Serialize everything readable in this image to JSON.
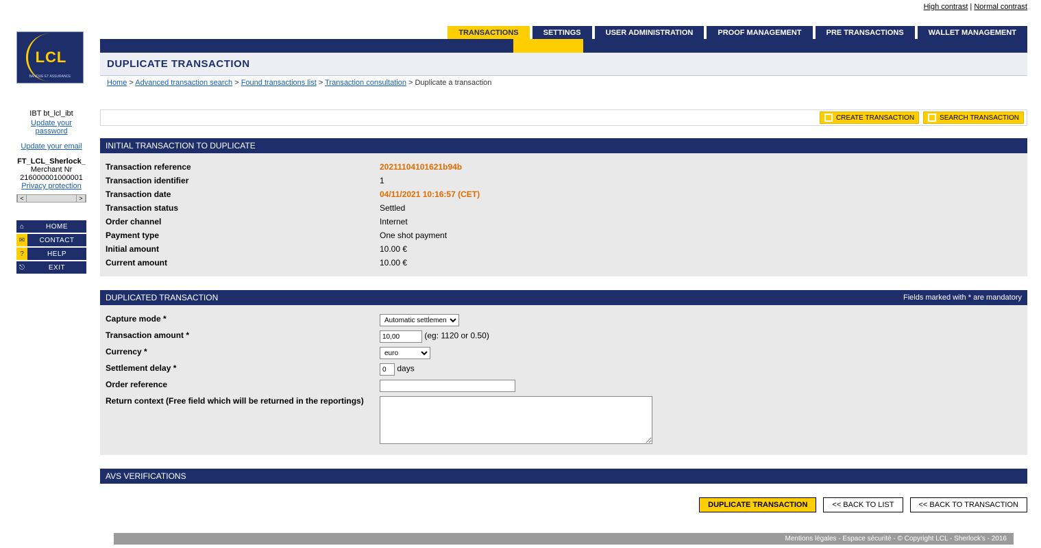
{
  "top_links": {
    "high": "High contrast",
    "sep": " | ",
    "normal": "Normal contrast"
  },
  "logo": {
    "brand": "LCL",
    "tag": "BANQUE ET ASSURANCE"
  },
  "tabs": [
    "TRANSACTIONS",
    "SETTINGS",
    "USER ADMINISTRATION",
    "PROOF MANAGEMENT",
    "PRE TRANSACTIONS",
    "WALLET MANAGEMENT"
  ],
  "tabs_active_index": 0,
  "page_title": "DUPLICATE TRANSACTION",
  "breadcrumb": {
    "items": [
      "Home",
      "Advanced transaction search",
      "Found transactions list",
      "Transaction consultation"
    ],
    "current": "Duplicate a transaction"
  },
  "sidebar": {
    "user_line": "IBT bt_lcl_ibt",
    "links": {
      "update_pwd": "Update your password",
      "update_email": "Update your email",
      "privacy": "Privacy protection"
    },
    "merchant_name": "FT_LCL_Sherlock_",
    "merchant_label": "Merchant Nr",
    "merchant_nr": "216000001000001",
    "buttons": {
      "home": "HOME",
      "contact": "CONTACT",
      "help": "HELP",
      "exit": "EXIT"
    }
  },
  "toolbar": {
    "create": "CREATE TRANSACTION",
    "search": "SEARCH TRANSACTION"
  },
  "panel1": {
    "title": "INITIAL TRANSACTION TO DUPLICATE",
    "rows": {
      "ref_l": "Transaction reference",
      "ref_v": "20211104101621b94b",
      "id_l": "Transaction identifier",
      "id_v": "1",
      "date_l": "Transaction date",
      "date_v": "04/11/2021 10:16:57 (CET)",
      "status_l": "Transaction status",
      "status_v": "Settled",
      "chan_l": "Order channel",
      "chan_v": "Internet",
      "pay_l": "Payment type",
      "pay_v": "One shot payment",
      "init_l": "Initial amount",
      "init_v": "10.00  €",
      "cur_l": "Current amount",
      "cur_v": "10.00  €"
    }
  },
  "panel2": {
    "title": "DUPLICATED TRANSACTION",
    "mandatory": "Fields marked with * are mandatory",
    "fields": {
      "capture_l": "Capture mode *",
      "capture_v": "Automatic settlement",
      "amount_l": "Transaction amount *",
      "amount_v": "10,00",
      "amount_hint": "(eg: 1120 or 0.50)",
      "currency_l": "Currency *",
      "currency_v": "euro",
      "delay_l": "Settlement delay *",
      "delay_v": "0",
      "delay_unit": "days",
      "order_l": "Order reference",
      "order_v": "",
      "ctx_l": "Return context (Free field which will be returned in the reportings)",
      "ctx_v": ""
    }
  },
  "panel3": {
    "title": "AVS VERIFICATIONS"
  },
  "buttons": {
    "dup": "DUPLICATE TRANSACTION",
    "back_list": "<< BACK TO LIST",
    "back_tx": "<< BACK TO TRANSACTION"
  },
  "footer": "Mentions légales - Espace sécurité - © Copyright LCL - Sherlock's - 2016"
}
